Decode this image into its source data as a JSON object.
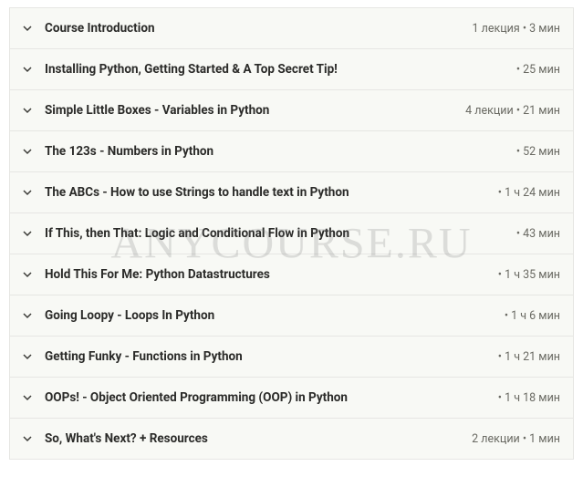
{
  "watermark": "ANYCOURSE.RU",
  "sections": [
    {
      "title": "Course Introduction",
      "meta": "1 лекция • 3 мин"
    },
    {
      "title": "Installing Python, Getting Started & A Top Secret Tip!",
      "meta": "• 25 мин"
    },
    {
      "title": "Simple Little Boxes - Variables in Python",
      "meta": "4 лекции • 21 мин"
    },
    {
      "title": "The 123s - Numbers in Python",
      "meta": "• 52 мин"
    },
    {
      "title": "The ABCs - How to use Strings to handle text in Python",
      "meta": "• 1 ч 24 мин"
    },
    {
      "title": "If This, then That: Logic and Conditional Flow in Python",
      "meta": "• 43 мин"
    },
    {
      "title": "Hold This For Me: Python Datastructures",
      "meta": "• 1 ч 35 мин"
    },
    {
      "title": "Going Loopy - Loops In Python",
      "meta": "• 1 ч 6 мин"
    },
    {
      "title": "Getting Funky - Functions in Python",
      "meta": "• 1 ч 21 мин"
    },
    {
      "title": "OOPs! - Object Oriented Programming (OOP) in Python",
      "meta": "• 1 ч 18 мин"
    },
    {
      "title": "So, What's Next? + Resources",
      "meta": "2 лекции • 1 мин"
    }
  ]
}
